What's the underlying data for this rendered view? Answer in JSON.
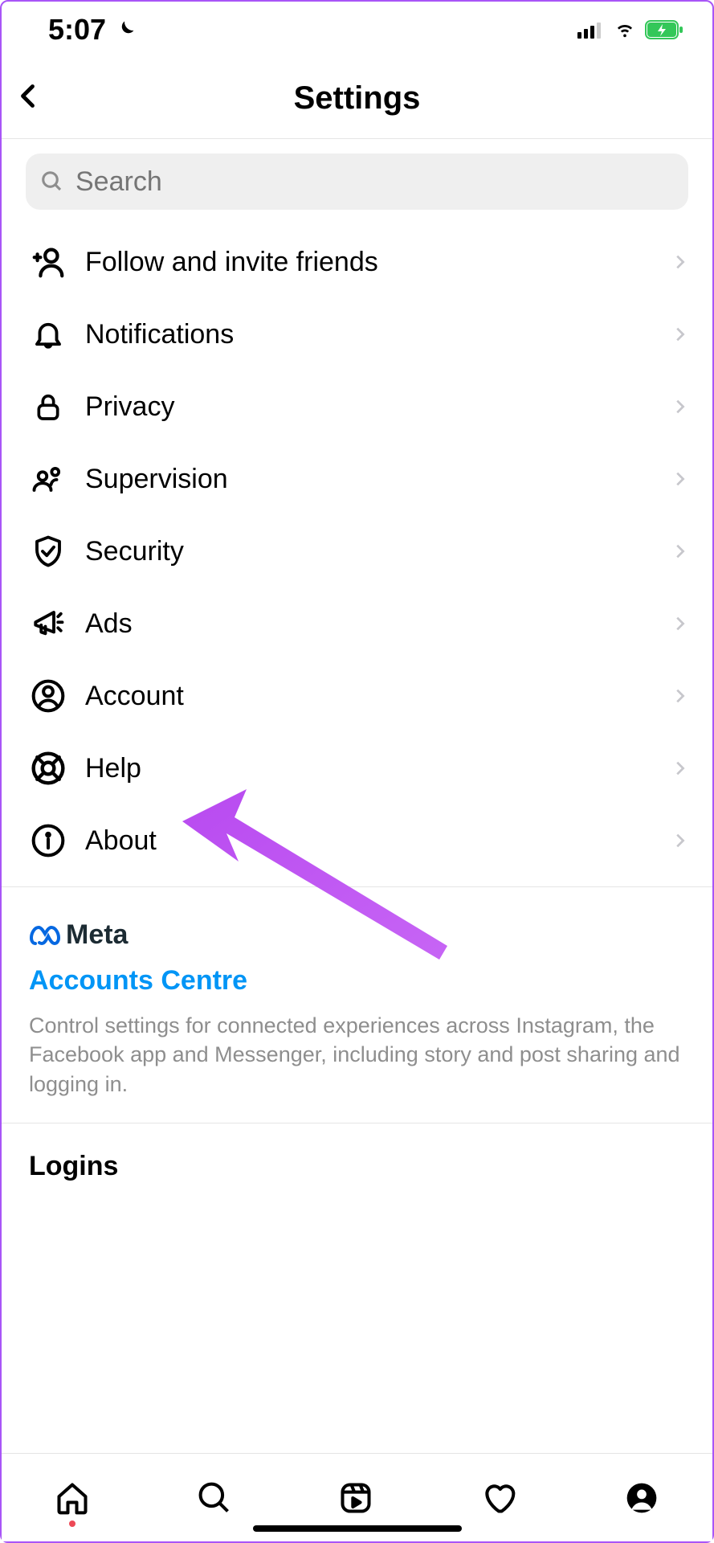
{
  "status_bar": {
    "time": "5:07"
  },
  "header": {
    "title": "Settings"
  },
  "search": {
    "placeholder": "Search"
  },
  "menu": {
    "items": [
      {
        "label": "Follow and invite friends",
        "icon": "invite-friends-icon"
      },
      {
        "label": "Notifications",
        "icon": "bell-icon"
      },
      {
        "label": "Privacy",
        "icon": "lock-icon"
      },
      {
        "label": "Supervision",
        "icon": "supervision-icon"
      },
      {
        "label": "Security",
        "icon": "shield-check-icon"
      },
      {
        "label": "Ads",
        "icon": "megaphone-icon"
      },
      {
        "label": "Account",
        "icon": "account-icon"
      },
      {
        "label": "Help",
        "icon": "lifebuoy-icon"
      },
      {
        "label": "About",
        "icon": "info-icon"
      }
    ]
  },
  "meta": {
    "brand": "Meta",
    "link": "Accounts Centre",
    "description": "Control settings for connected experiences across Instagram, the Facebook app and Messenger, including story and post sharing and logging in."
  },
  "logins": {
    "title": "Logins"
  },
  "annotation": {
    "arrow_color": "#b84af0"
  }
}
